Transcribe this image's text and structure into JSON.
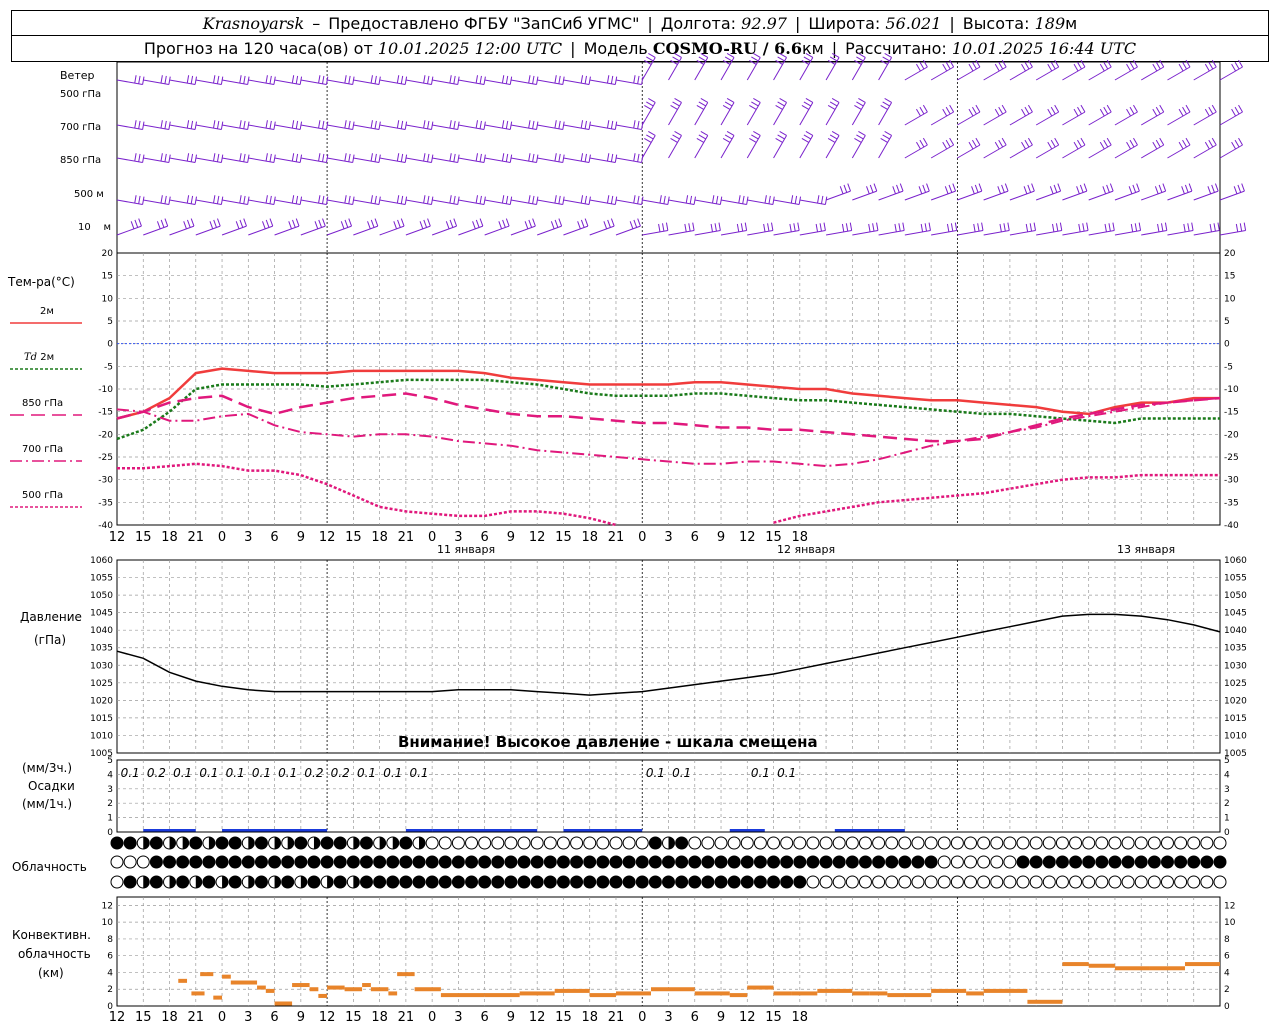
{
  "header": {
    "location": "Krasnoyarsk",
    "provider": "Предоставлено ФГБУ \"ЗапСиб УГМС\"",
    "lon_label": "Долгота:",
    "lon": "92.97",
    "lat_label": "Широта:",
    "lat": "56.021",
    "alt_label": "Высота:",
    "alt": "189",
    "alt_unit": "м",
    "forecast_label": "Прогноз на 120 часа(ов) от",
    "forecast_time": "10.01.2025 12:00 UTC",
    "model_label": "Модель",
    "model": "COSMO-RU / 6.6",
    "model_unit": "км",
    "calc_label": "Рассчитано:",
    "calc_time": "10.01.2025 16:44 UTC"
  },
  "labels": {
    "wind": "Ветер",
    "w500": "500 гПа",
    "w700": "700 гПа",
    "w850": "850 гПа",
    "w500m": "500 м",
    "w10": "10    м",
    "temp": "Тем-ра(°C)",
    "t2m": "2м",
    "td": "Td",
    "td2m": "2м",
    "t850": "850 гПа",
    "t700": "700 гПа",
    "t500": "500 гПа",
    "pressure": "Давление",
    "pressure_unit": "(гПа)",
    "precip1": "(мм/3ч.)",
    "precip2": "Осадки",
    "precip3": "(мм/1ч.)",
    "cloud": "Облачность",
    "conv1": "Конвективн.",
    "conv2": "облачность",
    "conv3": "(км)",
    "warning": "Внимание! Высокое давление - шкала смещена",
    "day1": "11 января",
    "day2": "12 января",
    "day3": "13 января"
  },
  "colors": {
    "t2m": "#f03c3c",
    "td": "#1a7a1a",
    "t850": "#e0187c",
    "t700": "#e0187c",
    "t500": "#e0187c",
    "wind": "#7a22cc",
    "pressure": "#000000",
    "precip": "#1a3adc",
    "conv": "#e8842a"
  },
  "chart_data": [
    {
      "type": "line",
      "title": "Тем-ра(°C)",
      "ylim": [
        -40,
        20
      ],
      "x_hours": [
        0,
        3,
        6,
        9,
        12,
        15,
        18,
        21,
        24,
        27,
        30,
        33,
        36,
        39,
        42,
        45,
        48,
        51,
        54,
        57,
        60,
        63,
        66,
        69,
        72,
        75,
        78,
        81,
        84,
        87,
        90,
        93,
        96,
        99,
        102,
        105,
        108,
        111,
        114,
        117,
        120,
        123,
        126
      ],
      "series": [
        {
          "name": "2м",
          "values": [
            -16.5,
            -15,
            -12,
            -6.5,
            -5.5,
            -6,
            -6.5,
            -6.5,
            -6.5,
            -6,
            -6,
            -6,
            -6,
            -6,
            -6.5,
            -7.5,
            -8,
            -8.5,
            -9,
            -9,
            -9,
            -9,
            -8.5,
            -8.5,
            -9,
            -9.5,
            -10,
            -10,
            -11,
            -11.5,
            -12,
            -12.5,
            -12.5,
            -13,
            -13.5,
            -14,
            -15,
            -15.5,
            -14,
            -13,
            -13,
            -12,
            -12
          ]
        },
        {
          "name": "Td 2м",
          "values": [
            -21,
            -19,
            -15,
            -10,
            -9,
            -9,
            -9,
            -9,
            -9.5,
            -9,
            -8.5,
            -8,
            -8,
            -8,
            -8,
            -8.5,
            -9,
            -10,
            -11,
            -11.5,
            -11.5,
            -11.5,
            -11,
            -11,
            -11.5,
            -12,
            -12.5,
            -12.5,
            -13,
            -13.5,
            -14,
            -14.5,
            -15,
            -15.5,
            -15.5,
            -16,
            -16.5,
            -17,
            -17.5,
            -16.5,
            -16.5,
            -16.5,
            -16.5
          ]
        },
        {
          "name": "850 гПа",
          "values": [
            -16.5,
            -15,
            -13,
            -12,
            -11.5,
            -14,
            -15.5,
            -14,
            -13,
            -12,
            -11.5,
            -11,
            -12,
            -13.5,
            -14.5,
            -15.5,
            -16,
            -16,
            -16.5,
            -17,
            -17.5,
            -17.5,
            -18,
            -18.5,
            -18.5,
            -19,
            -19,
            -19.5,
            -20,
            -20.5,
            -21,
            -21.5,
            -21.5,
            -21,
            -19.5,
            -18,
            -16.5,
            -15.5,
            -14.5,
            -13.5,
            -13,
            -12.5,
            -12
          ]
        },
        {
          "name": "700 гПа",
          "values": [
            -14.5,
            -15,
            -17,
            -17,
            -16,
            -15.5,
            -18,
            -19.5,
            -20,
            -20.5,
            -20,
            -20,
            -20.5,
            -21.5,
            -22,
            -22.5,
            -23.5,
            -24,
            -24.5,
            -25,
            -25.5,
            -26,
            -26.5,
            -26.5,
            -26,
            -26,
            -26.5,
            -27,
            -26.5,
            -25.5,
            -24,
            -22.5,
            -21.5,
            -20.5,
            -19.5,
            -18.5,
            -17,
            -16,
            -15,
            -14,
            -13,
            -12.5,
            -12
          ]
        },
        {
          "name": "500 гПа",
          "values": [
            -27.5,
            -27.5,
            -27,
            -26.5,
            -27,
            -28,
            -28,
            -29,
            -31,
            -33.5,
            -36,
            -37,
            -37.5,
            -38,
            -38,
            -37,
            -37,
            -37.5,
            -38.5,
            -40,
            -42,
            -44,
            -44,
            -43,
            -41,
            -39.5,
            -38,
            -37,
            -36,
            -35,
            -34.5,
            -34,
            -33.5,
            -33,
            -32,
            -31,
            -30,
            -29.5,
            -29.5,
            -29,
            -29,
            -29,
            -29
          ]
        }
      ]
    },
    {
      "type": "line",
      "title": "Давление",
      "ylim": [
        1005,
        1060
      ],
      "x_hours": [
        0,
        3,
        6,
        9,
        12,
        15,
        18,
        21,
        24,
        27,
        30,
        33,
        36,
        39,
        42,
        45,
        48,
        51,
        54,
        57,
        60,
        63,
        66,
        69,
        72,
        75,
        78,
        81,
        84,
        87,
        90,
        93,
        96,
        99,
        102,
        105,
        108,
        111,
        114,
        117,
        120,
        123,
        126
      ],
      "series": [
        {
          "name": "Давление",
          "values": [
            1034,
            1032,
            1028,
            1025.5,
            1024,
            1023,
            1022.5,
            1022.5,
            1022.5,
            1022.5,
            1022.5,
            1022.5,
            1022.5,
            1023,
            1023,
            1023,
            1022.5,
            1022,
            1021.5,
            1022,
            1022.5,
            1023.5,
            1024.5,
            1025.5,
            1026.5,
            1027.5,
            1029,
            1030.5,
            1032,
            1033.5,
            1035,
            1036.5,
            1038,
            1039.5,
            1041,
            1042.5,
            1044,
            1044.5,
            1044.5,
            1044,
            1043,
            1041.5,
            1039.5
          ]
        }
      ]
    },
    {
      "type": "bar",
      "title": "Осадки",
      "ylim": [
        0,
        5
      ],
      "labels_x_hours": [
        1.5,
        4.5,
        7.5,
        10.5,
        13.5,
        16.5,
        19.5,
        22.5,
        25.5,
        28.5,
        31.5,
        34.5,
        61.5,
        64.5,
        73.5,
        76.5
      ],
      "values": [
        "0.1",
        "0.2",
        "0.1",
        "0.1",
        "0.1",
        "0.1",
        "0.1",
        "0.2",
        "0.2",
        "0.1",
        "0.1",
        "0.1",
        "0.1",
        "0.1",
        "0.1",
        "0.1"
      ]
    },
    {
      "type": "bar",
      "title": "Конвективн. облачность",
      "ylim": [
        0,
        13
      ],
      "segments": [
        [
          7,
          8,
          3
        ],
        [
          8.5,
          10,
          1.5
        ],
        [
          9.5,
          11,
          3.8
        ],
        [
          11,
          12,
          1
        ],
        [
          12,
          13,
          3.5
        ],
        [
          13,
          16,
          2.8
        ],
        [
          16,
          17,
          2.2
        ],
        [
          17,
          18,
          1.8
        ],
        [
          18,
          20,
          0.3
        ],
        [
          20,
          22,
          2.5
        ],
        [
          22,
          23,
          2
        ],
        [
          23,
          24,
          1.2
        ],
        [
          24,
          26,
          2.2
        ],
        [
          26,
          28,
          2
        ],
        [
          28,
          29,
          2.5
        ],
        [
          29,
          31,
          2
        ],
        [
          31,
          32,
          1.5
        ],
        [
          32,
          34,
          3.8
        ],
        [
          34,
          37,
          2
        ],
        [
          37,
          42,
          1.3
        ],
        [
          42,
          46,
          1.3
        ],
        [
          46,
          50,
          1.5
        ],
        [
          50,
          54,
          1.8
        ],
        [
          54,
          57,
          1.3
        ],
        [
          57,
          61,
          1.5
        ],
        [
          61,
          66,
          2
        ],
        [
          66,
          70,
          1.5
        ],
        [
          70,
          72,
          1.3
        ],
        [
          72,
          75,
          2.2
        ],
        [
          75,
          77,
          1.5
        ],
        [
          77,
          80,
          1.5
        ],
        [
          80,
          84,
          1.8
        ],
        [
          84,
          86,
          1.5
        ],
        [
          86,
          88,
          1.5
        ],
        [
          88,
          90,
          1.3
        ],
        [
          90,
          93,
          1.3
        ],
        [
          93,
          97,
          1.8
        ],
        [
          97,
          99,
          1.5
        ],
        [
          99,
          104,
          1.8
        ],
        [
          104,
          108,
          0.5
        ],
        [
          108,
          111,
          5
        ],
        [
          111,
          114,
          4.8
        ],
        [
          114,
          118,
          4.5
        ],
        [
          118,
          122,
          4.5
        ],
        [
          122,
          126,
          5
        ]
      ]
    }
  ],
  "time_axis": {
    "ticks": [
      "12",
      "15",
      "18",
      "21",
      "0",
      "3",
      "6",
      "9",
      "12",
      "15",
      "18",
      "21",
      "0",
      "3",
      "6",
      "9",
      "12",
      "15",
      "18",
      "21",
      "0",
      "3",
      "6",
      "9",
      "12",
      "15",
      "18"
    ]
  }
}
